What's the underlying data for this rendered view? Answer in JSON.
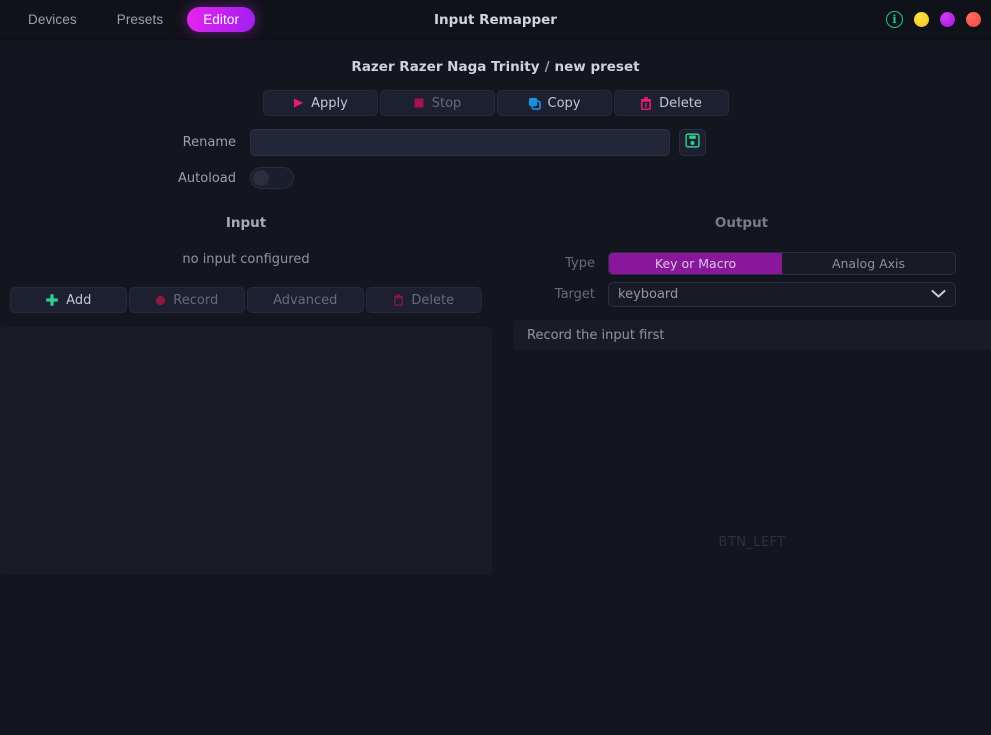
{
  "window": {
    "title": "Input Remapper",
    "nav_tabs": [
      {
        "label": "Devices",
        "active": false
      },
      {
        "label": "Presets",
        "active": false
      },
      {
        "label": "Editor",
        "active": true
      }
    ],
    "controls": {
      "info_label": "i",
      "info_icon": "info-circle-icon",
      "minimize_icon": "minimize-dot-icon",
      "maximize_icon": "maximize-dot-icon",
      "close_icon": "close-dot-icon"
    },
    "colors": {
      "accent_active_tab_start": "#e624f0",
      "accent_active_tab_end": "#a01ff0",
      "info_green": "#1ecb8b",
      "minimize_yellow": "#f5c518",
      "maximize_purple": "#a813e0",
      "close_red": "#f2453d",
      "segment_active": "#8a179b",
      "apply_pink": "#f0197a",
      "stop_crimson": "#a8114f",
      "copy_blue": "#1a8fe0",
      "delete_pink": "#f0197a",
      "add_green": "#2fd18a",
      "record_red": "#8f1640",
      "save_green": "#2fd18a",
      "background": "#14161f",
      "panel": "#191c27"
    }
  },
  "preset": {
    "device_name": "Razer Razer Naga Trinity",
    "separator": "/",
    "preset_name": "new preset"
  },
  "actions": [
    {
      "label": "Apply",
      "icon": "play-triangle-icon",
      "disabled": false
    },
    {
      "label": "Stop",
      "icon": "stop-square-icon",
      "disabled": true
    },
    {
      "label": "Copy",
      "icon": "copy-icon",
      "disabled": false
    },
    {
      "label": "Delete",
      "icon": "trash-icon",
      "disabled": false
    }
  ],
  "rename": {
    "label": "Rename",
    "value": "",
    "placeholder": "",
    "save_icon": "floppy-save-icon"
  },
  "autoload": {
    "label": "Autoload",
    "enabled": false
  },
  "input_section": {
    "title": "Input",
    "empty_text": "no input configured",
    "buttons": [
      {
        "label": "Add",
        "icon": "plus-icon",
        "disabled": false
      },
      {
        "label": "Record",
        "icon": "record-dot-icon",
        "disabled": true
      },
      {
        "label": "Advanced",
        "icon": "",
        "disabled": true
      },
      {
        "label": "Delete",
        "icon": "trash-icon",
        "disabled": true
      }
    ]
  },
  "output_section": {
    "title": "Output",
    "type": {
      "label": "Type",
      "options": [
        {
          "label": "Key or Macro",
          "active": true
        },
        {
          "label": "Analog Axis",
          "active": false
        }
      ]
    },
    "target": {
      "label": "Target",
      "value": "keyboard",
      "chevron_icon": "chevron-down-icon"
    },
    "hint": "Record the input first",
    "editor_placeholder": "BTN_LEFT"
  }
}
